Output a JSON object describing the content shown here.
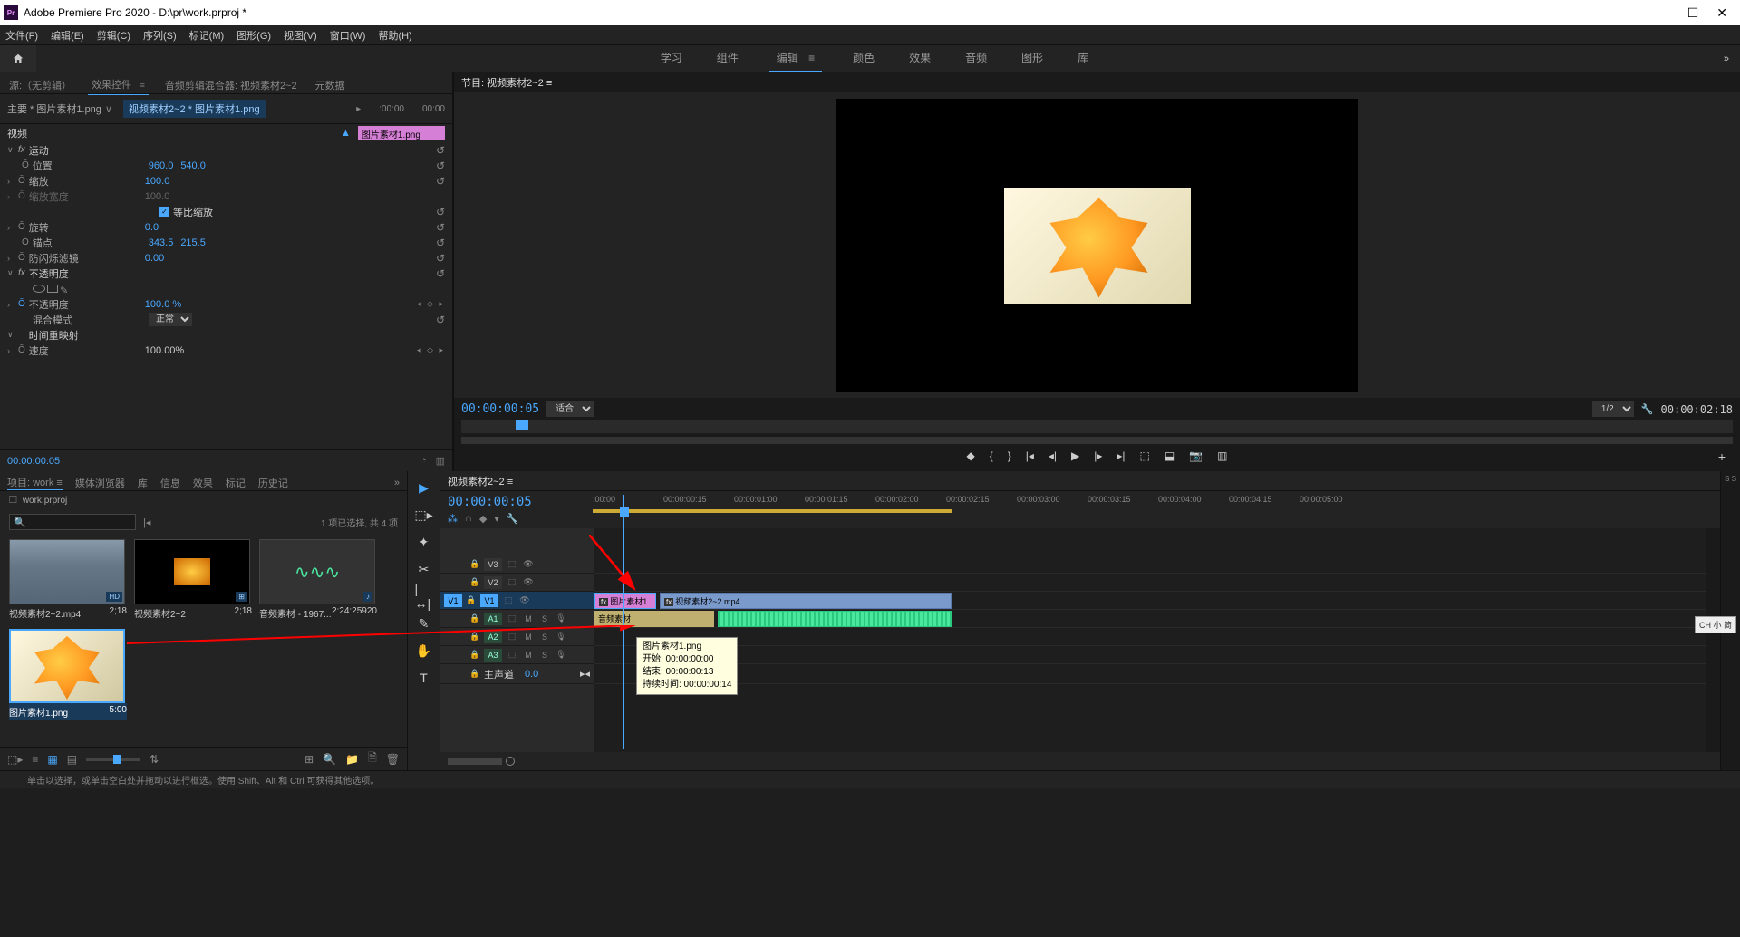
{
  "titlebar": {
    "app_icon_text": "Pr",
    "title": "Adobe Premiere Pro 2020 - D:\\pr\\work.prproj *"
  },
  "menubar": [
    "文件(F)",
    "编辑(E)",
    "剪辑(C)",
    "序列(S)",
    "标记(M)",
    "图形(G)",
    "视图(V)",
    "窗口(W)",
    "帮助(H)"
  ],
  "workspaces": [
    "学习",
    "组件",
    "编辑",
    "颜色",
    "效果",
    "音频",
    "图形",
    "库"
  ],
  "source_tabs": [
    "源:（无剪辑）",
    "效果控件",
    "音频剪辑混合器: 视频素材2~2",
    "元数据"
  ],
  "breadcrumb": {
    "bc1": "主要 * 图片素材1.png",
    "bc2": "视频素材2~2 * 图片素材1.png"
  },
  "effect_timeline": {
    "t0": ":00:00",
    "t1": "00:00",
    "clip_label": "图片素材1.png"
  },
  "effects": {
    "video_header": "视频",
    "motion": "运动",
    "position": {
      "label": "位置",
      "x": "960.0",
      "y": "540.0"
    },
    "scale": {
      "label": "缩放",
      "v": "100.0"
    },
    "scale_w": {
      "label": "缩放宽度",
      "v": "100.0"
    },
    "uniform": "等比缩放",
    "rotation": {
      "label": "旋转",
      "v": "0.0"
    },
    "anchor": {
      "label": "锚点",
      "x": "343.5",
      "y": "215.5"
    },
    "flicker": {
      "label": "防闪烁滤镜",
      "v": "0.00"
    },
    "opacity": {
      "header": "不透明度",
      "label": "不透明度",
      "v": "100.0 %",
      "blend": "混合模式",
      "blend_v": "正常"
    },
    "time": {
      "header": "时间重映射",
      "speed": "速度",
      "v": "100.00%"
    }
  },
  "left_footer_tc": "00:00:00:05",
  "program": {
    "title": "节目: 视频素材2~2",
    "tc_left": "00:00:00:05",
    "fit": "适合",
    "scale_options": [
      "1/2"
    ],
    "tc_right": "00:00:02:18"
  },
  "project": {
    "tabs": [
      "项目: work",
      "媒体浏览器",
      "库",
      "信息",
      "效果",
      "标记",
      "历史记"
    ],
    "folder": "work.prproj",
    "status": "1 项已选择, 共 4 项",
    "items": [
      {
        "name": "视频素材2~2.mp4",
        "dur": "2;18"
      },
      {
        "name": "视频素材2~2",
        "dur": "2;18"
      },
      {
        "name": "音频素材 - 1967...",
        "dur": "2:24:25920"
      },
      {
        "name": "图片素材1.png",
        "dur": "5:00"
      }
    ]
  },
  "timeline": {
    "title": "视频素材2~2",
    "tc": "00:00:00:05",
    "ruler": [
      ":00:00",
      "00:00:00:15",
      "00:00:01:00",
      "00:00:01:15",
      "00:00:02:00",
      "00:00:02:15",
      "00:00:03:00",
      "00:00:03:15",
      "00:00:04:00",
      "00:00:04:15",
      "00:00:05:00"
    ],
    "tracks_v": [
      "V3",
      "V2",
      "V1"
    ],
    "tracks_a": [
      "A1",
      "A2",
      "A3"
    ],
    "master": "主声道",
    "master_val": "0.0",
    "src_v1": "V1",
    "clips": {
      "image": "图片素材1",
      "video": "视频素材2~2.mp4",
      "audio_label": "音频素材"
    },
    "tooltip": {
      "name": "图片素材1.png",
      "start": "开始: 00:00:00:00",
      "end": "结束: 00:00:00:13",
      "duration": "持续时间: 00:00:00:14"
    }
  },
  "ch_badge": "CH 小 简",
  "status_bar": "单击以选择，或单击空白处并拖动以进行框选。使用 Shift、Alt 和 Ctrl 可获得其他选项。"
}
